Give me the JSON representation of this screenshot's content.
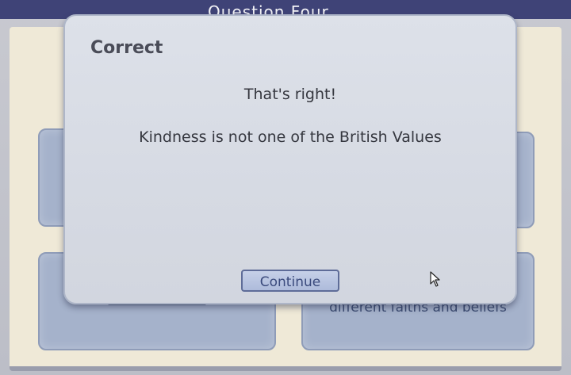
{
  "header": {
    "title": "Question Four"
  },
  "tiles": {
    "right_bottom_text": "different faiths and beliefs"
  },
  "dialog": {
    "title": "Correct",
    "headline": "That's right!",
    "message": "Kindness is not one of the British Values",
    "continue_label": "Continue"
  },
  "icons": {
    "cursor": "mouse-pointer-icon"
  },
  "colors": {
    "topbar": "#3f4377",
    "panel": "#efe9d7",
    "tile": "#a5b2cb",
    "dialog": "#d8dce5",
    "button": "#b8c4e0"
  }
}
